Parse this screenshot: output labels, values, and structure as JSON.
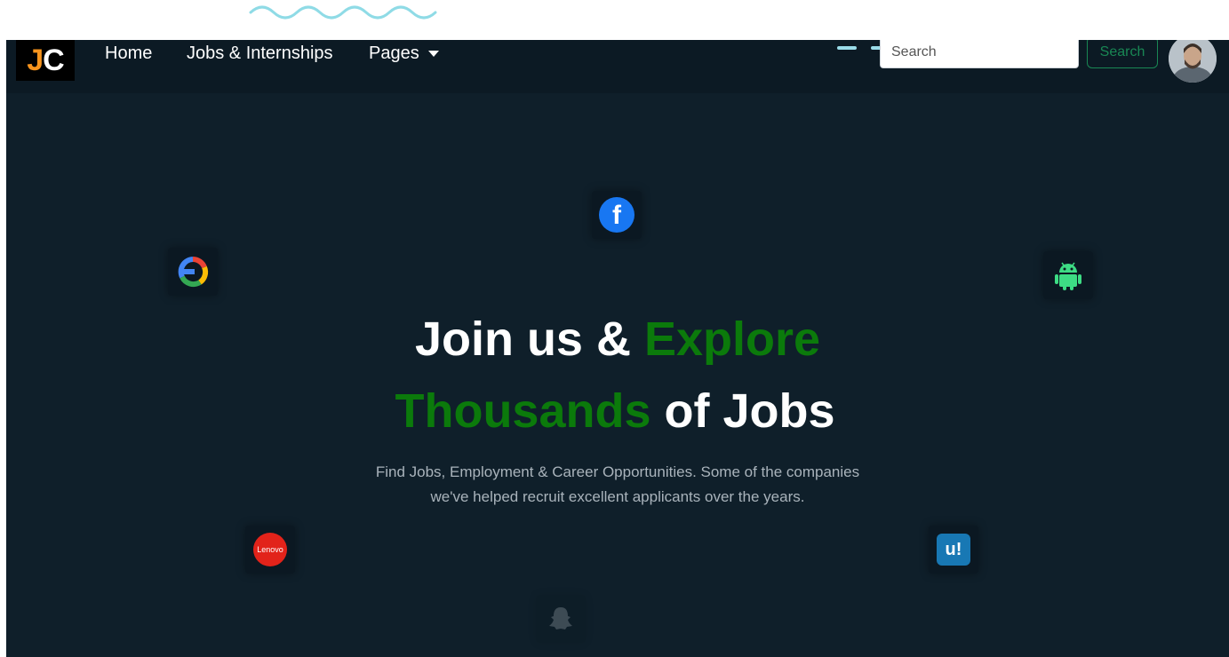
{
  "brand": {
    "letter_j": "J",
    "letter_c": "C"
  },
  "nav": {
    "links": [
      {
        "label": "Home"
      },
      {
        "label": "Jobs & Internships"
      },
      {
        "label": "Pages"
      }
    ]
  },
  "search": {
    "placeholder": "Search",
    "button_label": "Search"
  },
  "hero": {
    "title_line1_white": "Join us & ",
    "title_line1_green": "Explore",
    "title_line2_green": "Thousands",
    "title_line2_white": " of Jobs",
    "subtitle_line1": "Find Jobs, Employment & Career Opportunities. Some of the companies",
    "subtitle_line2": "we've helped recruit excellent applicants over the years."
  },
  "company_logos": [
    {
      "icon": "facebook-icon",
      "text": "f"
    },
    {
      "icon": "google-icon"
    },
    {
      "icon": "android-icon"
    },
    {
      "icon": "lenovo-icon",
      "text": "Lenovo"
    },
    {
      "icon": "upwork-icon",
      "text": "u!"
    },
    {
      "icon": "snapchat-icon"
    }
  ],
  "colors": {
    "background": "#0f1f2a",
    "navbar": "#0c1a24",
    "accent_green": "#0b7a0b",
    "search_button": "#198754",
    "brand_orange": "#f7941d"
  }
}
